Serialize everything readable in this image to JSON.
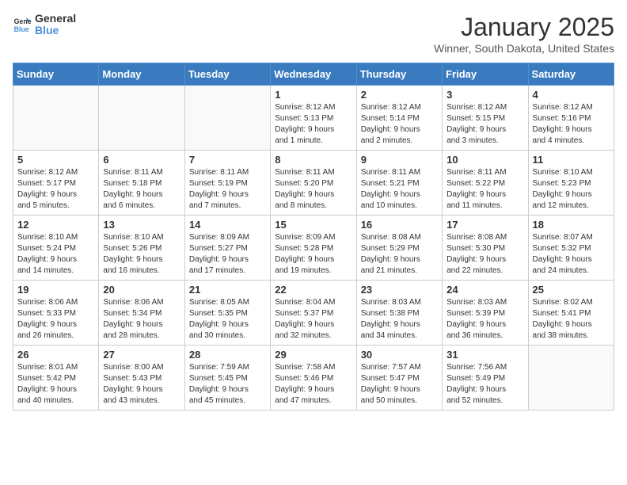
{
  "header": {
    "logo_general": "General",
    "logo_blue": "Blue",
    "month_title": "January 2025",
    "location": "Winner, South Dakota, United States"
  },
  "weekdays": [
    "Sunday",
    "Monday",
    "Tuesday",
    "Wednesday",
    "Thursday",
    "Friday",
    "Saturday"
  ],
  "weeks": [
    [
      {
        "num": "",
        "info": ""
      },
      {
        "num": "",
        "info": ""
      },
      {
        "num": "",
        "info": ""
      },
      {
        "num": "1",
        "info": "Sunrise: 8:12 AM\nSunset: 5:13 PM\nDaylight: 9 hours\nand 1 minute."
      },
      {
        "num": "2",
        "info": "Sunrise: 8:12 AM\nSunset: 5:14 PM\nDaylight: 9 hours\nand 2 minutes."
      },
      {
        "num": "3",
        "info": "Sunrise: 8:12 AM\nSunset: 5:15 PM\nDaylight: 9 hours\nand 3 minutes."
      },
      {
        "num": "4",
        "info": "Sunrise: 8:12 AM\nSunset: 5:16 PM\nDaylight: 9 hours\nand 4 minutes."
      }
    ],
    [
      {
        "num": "5",
        "info": "Sunrise: 8:12 AM\nSunset: 5:17 PM\nDaylight: 9 hours\nand 5 minutes."
      },
      {
        "num": "6",
        "info": "Sunrise: 8:11 AM\nSunset: 5:18 PM\nDaylight: 9 hours\nand 6 minutes."
      },
      {
        "num": "7",
        "info": "Sunrise: 8:11 AM\nSunset: 5:19 PM\nDaylight: 9 hours\nand 7 minutes."
      },
      {
        "num": "8",
        "info": "Sunrise: 8:11 AM\nSunset: 5:20 PM\nDaylight: 9 hours\nand 8 minutes."
      },
      {
        "num": "9",
        "info": "Sunrise: 8:11 AM\nSunset: 5:21 PM\nDaylight: 9 hours\nand 10 minutes."
      },
      {
        "num": "10",
        "info": "Sunrise: 8:11 AM\nSunset: 5:22 PM\nDaylight: 9 hours\nand 11 minutes."
      },
      {
        "num": "11",
        "info": "Sunrise: 8:10 AM\nSunset: 5:23 PM\nDaylight: 9 hours\nand 12 minutes."
      }
    ],
    [
      {
        "num": "12",
        "info": "Sunrise: 8:10 AM\nSunset: 5:24 PM\nDaylight: 9 hours\nand 14 minutes."
      },
      {
        "num": "13",
        "info": "Sunrise: 8:10 AM\nSunset: 5:26 PM\nDaylight: 9 hours\nand 16 minutes."
      },
      {
        "num": "14",
        "info": "Sunrise: 8:09 AM\nSunset: 5:27 PM\nDaylight: 9 hours\nand 17 minutes."
      },
      {
        "num": "15",
        "info": "Sunrise: 8:09 AM\nSunset: 5:28 PM\nDaylight: 9 hours\nand 19 minutes."
      },
      {
        "num": "16",
        "info": "Sunrise: 8:08 AM\nSunset: 5:29 PM\nDaylight: 9 hours\nand 21 minutes."
      },
      {
        "num": "17",
        "info": "Sunrise: 8:08 AM\nSunset: 5:30 PM\nDaylight: 9 hours\nand 22 minutes."
      },
      {
        "num": "18",
        "info": "Sunrise: 8:07 AM\nSunset: 5:32 PM\nDaylight: 9 hours\nand 24 minutes."
      }
    ],
    [
      {
        "num": "19",
        "info": "Sunrise: 8:06 AM\nSunset: 5:33 PM\nDaylight: 9 hours\nand 26 minutes."
      },
      {
        "num": "20",
        "info": "Sunrise: 8:06 AM\nSunset: 5:34 PM\nDaylight: 9 hours\nand 28 minutes."
      },
      {
        "num": "21",
        "info": "Sunrise: 8:05 AM\nSunset: 5:35 PM\nDaylight: 9 hours\nand 30 minutes."
      },
      {
        "num": "22",
        "info": "Sunrise: 8:04 AM\nSunset: 5:37 PM\nDaylight: 9 hours\nand 32 minutes."
      },
      {
        "num": "23",
        "info": "Sunrise: 8:03 AM\nSunset: 5:38 PM\nDaylight: 9 hours\nand 34 minutes."
      },
      {
        "num": "24",
        "info": "Sunrise: 8:03 AM\nSunset: 5:39 PM\nDaylight: 9 hours\nand 36 minutes."
      },
      {
        "num": "25",
        "info": "Sunrise: 8:02 AM\nSunset: 5:41 PM\nDaylight: 9 hours\nand 38 minutes."
      }
    ],
    [
      {
        "num": "26",
        "info": "Sunrise: 8:01 AM\nSunset: 5:42 PM\nDaylight: 9 hours\nand 40 minutes."
      },
      {
        "num": "27",
        "info": "Sunrise: 8:00 AM\nSunset: 5:43 PM\nDaylight: 9 hours\nand 43 minutes."
      },
      {
        "num": "28",
        "info": "Sunrise: 7:59 AM\nSunset: 5:45 PM\nDaylight: 9 hours\nand 45 minutes."
      },
      {
        "num": "29",
        "info": "Sunrise: 7:58 AM\nSunset: 5:46 PM\nDaylight: 9 hours\nand 47 minutes."
      },
      {
        "num": "30",
        "info": "Sunrise: 7:57 AM\nSunset: 5:47 PM\nDaylight: 9 hours\nand 50 minutes."
      },
      {
        "num": "31",
        "info": "Sunrise: 7:56 AM\nSunset: 5:49 PM\nDaylight: 9 hours\nand 52 minutes."
      },
      {
        "num": "",
        "info": ""
      }
    ]
  ]
}
